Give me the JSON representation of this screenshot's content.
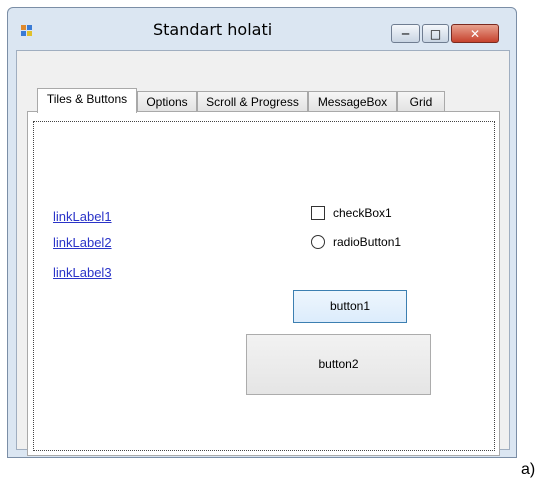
{
  "window": {
    "title": "Standart holati",
    "controls": {
      "minimize": "─",
      "maximize": "□",
      "close": "✕"
    },
    "colors": {
      "close_button": "#c6422d",
      "frame": "#dbe6f2"
    }
  },
  "tabs": [
    {
      "label": "Tiles & Buttons",
      "active": true
    },
    {
      "label": "Options",
      "active": false
    },
    {
      "label": "Scroll & Progress",
      "active": false
    },
    {
      "label": "MessageBox",
      "active": false
    },
    {
      "label": "Grid",
      "active": false
    }
  ],
  "links": [
    "linkLabel1",
    "linkLabel2",
    "linkLabel3"
  ],
  "checkbox": {
    "label": "checkBox1",
    "checked": false
  },
  "radio": {
    "label": "radioButton1",
    "selected": false
  },
  "buttons": {
    "button1": "button1",
    "button2": "button2"
  },
  "caption": "a)",
  "colors": {
    "link": "#2a33c8",
    "focus_border": "#3c7fb1"
  }
}
